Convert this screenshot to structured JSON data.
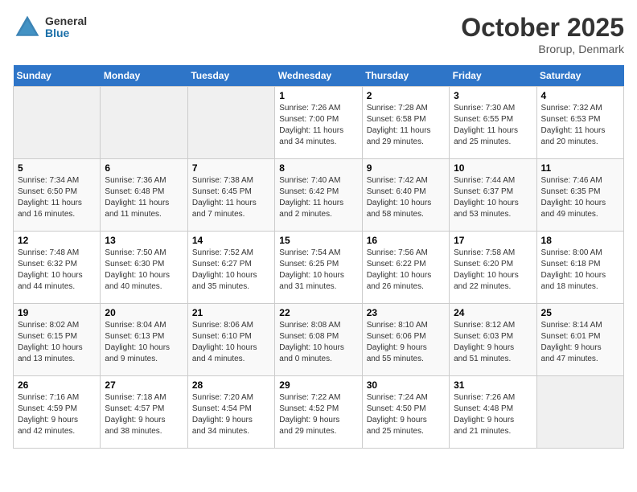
{
  "header": {
    "logo_general": "General",
    "logo_blue": "Blue",
    "month": "October 2025",
    "location": "Brorup, Denmark"
  },
  "days_of_week": [
    "Sunday",
    "Monday",
    "Tuesday",
    "Wednesday",
    "Thursday",
    "Friday",
    "Saturday"
  ],
  "weeks": [
    [
      {
        "day": "",
        "detail": ""
      },
      {
        "day": "",
        "detail": ""
      },
      {
        "day": "",
        "detail": ""
      },
      {
        "day": "1",
        "detail": "Sunrise: 7:26 AM\nSunset: 7:00 PM\nDaylight: 11 hours\nand 34 minutes."
      },
      {
        "day": "2",
        "detail": "Sunrise: 7:28 AM\nSunset: 6:58 PM\nDaylight: 11 hours\nand 29 minutes."
      },
      {
        "day": "3",
        "detail": "Sunrise: 7:30 AM\nSunset: 6:55 PM\nDaylight: 11 hours\nand 25 minutes."
      },
      {
        "day": "4",
        "detail": "Sunrise: 7:32 AM\nSunset: 6:53 PM\nDaylight: 11 hours\nand 20 minutes."
      }
    ],
    [
      {
        "day": "5",
        "detail": "Sunrise: 7:34 AM\nSunset: 6:50 PM\nDaylight: 11 hours\nand 16 minutes."
      },
      {
        "day": "6",
        "detail": "Sunrise: 7:36 AM\nSunset: 6:48 PM\nDaylight: 11 hours\nand 11 minutes."
      },
      {
        "day": "7",
        "detail": "Sunrise: 7:38 AM\nSunset: 6:45 PM\nDaylight: 11 hours\nand 7 minutes."
      },
      {
        "day": "8",
        "detail": "Sunrise: 7:40 AM\nSunset: 6:42 PM\nDaylight: 11 hours\nand 2 minutes."
      },
      {
        "day": "9",
        "detail": "Sunrise: 7:42 AM\nSunset: 6:40 PM\nDaylight: 10 hours\nand 58 minutes."
      },
      {
        "day": "10",
        "detail": "Sunrise: 7:44 AM\nSunset: 6:37 PM\nDaylight: 10 hours\nand 53 minutes."
      },
      {
        "day": "11",
        "detail": "Sunrise: 7:46 AM\nSunset: 6:35 PM\nDaylight: 10 hours\nand 49 minutes."
      }
    ],
    [
      {
        "day": "12",
        "detail": "Sunrise: 7:48 AM\nSunset: 6:32 PM\nDaylight: 10 hours\nand 44 minutes."
      },
      {
        "day": "13",
        "detail": "Sunrise: 7:50 AM\nSunset: 6:30 PM\nDaylight: 10 hours\nand 40 minutes."
      },
      {
        "day": "14",
        "detail": "Sunrise: 7:52 AM\nSunset: 6:27 PM\nDaylight: 10 hours\nand 35 minutes."
      },
      {
        "day": "15",
        "detail": "Sunrise: 7:54 AM\nSunset: 6:25 PM\nDaylight: 10 hours\nand 31 minutes."
      },
      {
        "day": "16",
        "detail": "Sunrise: 7:56 AM\nSunset: 6:22 PM\nDaylight: 10 hours\nand 26 minutes."
      },
      {
        "day": "17",
        "detail": "Sunrise: 7:58 AM\nSunset: 6:20 PM\nDaylight: 10 hours\nand 22 minutes."
      },
      {
        "day": "18",
        "detail": "Sunrise: 8:00 AM\nSunset: 6:18 PM\nDaylight: 10 hours\nand 18 minutes."
      }
    ],
    [
      {
        "day": "19",
        "detail": "Sunrise: 8:02 AM\nSunset: 6:15 PM\nDaylight: 10 hours\nand 13 minutes."
      },
      {
        "day": "20",
        "detail": "Sunrise: 8:04 AM\nSunset: 6:13 PM\nDaylight: 10 hours\nand 9 minutes."
      },
      {
        "day": "21",
        "detail": "Sunrise: 8:06 AM\nSunset: 6:10 PM\nDaylight: 10 hours\nand 4 minutes."
      },
      {
        "day": "22",
        "detail": "Sunrise: 8:08 AM\nSunset: 6:08 PM\nDaylight: 10 hours\nand 0 minutes."
      },
      {
        "day": "23",
        "detail": "Sunrise: 8:10 AM\nSunset: 6:06 PM\nDaylight: 9 hours\nand 55 minutes."
      },
      {
        "day": "24",
        "detail": "Sunrise: 8:12 AM\nSunset: 6:03 PM\nDaylight: 9 hours\nand 51 minutes."
      },
      {
        "day": "25",
        "detail": "Sunrise: 8:14 AM\nSunset: 6:01 PM\nDaylight: 9 hours\nand 47 minutes."
      }
    ],
    [
      {
        "day": "26",
        "detail": "Sunrise: 7:16 AM\nSunset: 4:59 PM\nDaylight: 9 hours\nand 42 minutes."
      },
      {
        "day": "27",
        "detail": "Sunrise: 7:18 AM\nSunset: 4:57 PM\nDaylight: 9 hours\nand 38 minutes."
      },
      {
        "day": "28",
        "detail": "Sunrise: 7:20 AM\nSunset: 4:54 PM\nDaylight: 9 hours\nand 34 minutes."
      },
      {
        "day": "29",
        "detail": "Sunrise: 7:22 AM\nSunset: 4:52 PM\nDaylight: 9 hours\nand 29 minutes."
      },
      {
        "day": "30",
        "detail": "Sunrise: 7:24 AM\nSunset: 4:50 PM\nDaylight: 9 hours\nand 25 minutes."
      },
      {
        "day": "31",
        "detail": "Sunrise: 7:26 AM\nSunset: 4:48 PM\nDaylight: 9 hours\nand 21 minutes."
      },
      {
        "day": "",
        "detail": ""
      }
    ]
  ]
}
